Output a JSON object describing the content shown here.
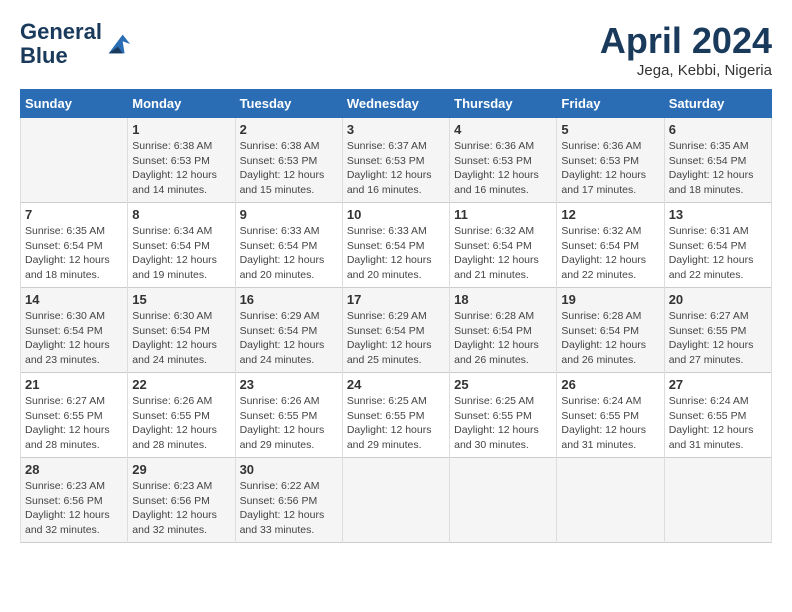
{
  "header": {
    "logo_line1": "General",
    "logo_line2": "Blue",
    "month_year": "April 2024",
    "location": "Jega, Kebbi, Nigeria"
  },
  "days_of_week": [
    "Sunday",
    "Monday",
    "Tuesday",
    "Wednesday",
    "Thursday",
    "Friday",
    "Saturday"
  ],
  "weeks": [
    [
      {
        "day": "",
        "sunrise": "",
        "sunset": "",
        "daylight": ""
      },
      {
        "day": "1",
        "sunrise": "6:38 AM",
        "sunset": "6:53 PM",
        "daylight": "12 hours and 14 minutes."
      },
      {
        "day": "2",
        "sunrise": "6:38 AM",
        "sunset": "6:53 PM",
        "daylight": "12 hours and 15 minutes."
      },
      {
        "day": "3",
        "sunrise": "6:37 AM",
        "sunset": "6:53 PM",
        "daylight": "12 hours and 16 minutes."
      },
      {
        "day": "4",
        "sunrise": "6:36 AM",
        "sunset": "6:53 PM",
        "daylight": "12 hours and 16 minutes."
      },
      {
        "day": "5",
        "sunrise": "6:36 AM",
        "sunset": "6:53 PM",
        "daylight": "12 hours and 17 minutes."
      },
      {
        "day": "6",
        "sunrise": "6:35 AM",
        "sunset": "6:54 PM",
        "daylight": "12 hours and 18 minutes."
      }
    ],
    [
      {
        "day": "7",
        "sunrise": "6:35 AM",
        "sunset": "6:54 PM",
        "daylight": "12 hours and 18 minutes."
      },
      {
        "day": "8",
        "sunrise": "6:34 AM",
        "sunset": "6:54 PM",
        "daylight": "12 hours and 19 minutes."
      },
      {
        "day": "9",
        "sunrise": "6:33 AM",
        "sunset": "6:54 PM",
        "daylight": "12 hours and 20 minutes."
      },
      {
        "day": "10",
        "sunrise": "6:33 AM",
        "sunset": "6:54 PM",
        "daylight": "12 hours and 20 minutes."
      },
      {
        "day": "11",
        "sunrise": "6:32 AM",
        "sunset": "6:54 PM",
        "daylight": "12 hours and 21 minutes."
      },
      {
        "day": "12",
        "sunrise": "6:32 AM",
        "sunset": "6:54 PM",
        "daylight": "12 hours and 22 minutes."
      },
      {
        "day": "13",
        "sunrise": "6:31 AM",
        "sunset": "6:54 PM",
        "daylight": "12 hours and 22 minutes."
      }
    ],
    [
      {
        "day": "14",
        "sunrise": "6:30 AM",
        "sunset": "6:54 PM",
        "daylight": "12 hours and 23 minutes."
      },
      {
        "day": "15",
        "sunrise": "6:30 AM",
        "sunset": "6:54 PM",
        "daylight": "12 hours and 24 minutes."
      },
      {
        "day": "16",
        "sunrise": "6:29 AM",
        "sunset": "6:54 PM",
        "daylight": "12 hours and 24 minutes."
      },
      {
        "day": "17",
        "sunrise": "6:29 AM",
        "sunset": "6:54 PM",
        "daylight": "12 hours and 25 minutes."
      },
      {
        "day": "18",
        "sunrise": "6:28 AM",
        "sunset": "6:54 PM",
        "daylight": "12 hours and 26 minutes."
      },
      {
        "day": "19",
        "sunrise": "6:28 AM",
        "sunset": "6:54 PM",
        "daylight": "12 hours and 26 minutes."
      },
      {
        "day": "20",
        "sunrise": "6:27 AM",
        "sunset": "6:55 PM",
        "daylight": "12 hours and 27 minutes."
      }
    ],
    [
      {
        "day": "21",
        "sunrise": "6:27 AM",
        "sunset": "6:55 PM",
        "daylight": "12 hours and 28 minutes."
      },
      {
        "day": "22",
        "sunrise": "6:26 AM",
        "sunset": "6:55 PM",
        "daylight": "12 hours and 28 minutes."
      },
      {
        "day": "23",
        "sunrise": "6:26 AM",
        "sunset": "6:55 PM",
        "daylight": "12 hours and 29 minutes."
      },
      {
        "day": "24",
        "sunrise": "6:25 AM",
        "sunset": "6:55 PM",
        "daylight": "12 hours and 29 minutes."
      },
      {
        "day": "25",
        "sunrise": "6:25 AM",
        "sunset": "6:55 PM",
        "daylight": "12 hours and 30 minutes."
      },
      {
        "day": "26",
        "sunrise": "6:24 AM",
        "sunset": "6:55 PM",
        "daylight": "12 hours and 31 minutes."
      },
      {
        "day": "27",
        "sunrise": "6:24 AM",
        "sunset": "6:55 PM",
        "daylight": "12 hours and 31 minutes."
      }
    ],
    [
      {
        "day": "28",
        "sunrise": "6:23 AM",
        "sunset": "6:56 PM",
        "daylight": "12 hours and 32 minutes."
      },
      {
        "day": "29",
        "sunrise": "6:23 AM",
        "sunset": "6:56 PM",
        "daylight": "12 hours and 32 minutes."
      },
      {
        "day": "30",
        "sunrise": "6:22 AM",
        "sunset": "6:56 PM",
        "daylight": "12 hours and 33 minutes."
      },
      {
        "day": "",
        "sunrise": "",
        "sunset": "",
        "daylight": ""
      },
      {
        "day": "",
        "sunrise": "",
        "sunset": "",
        "daylight": ""
      },
      {
        "day": "",
        "sunrise": "",
        "sunset": "",
        "daylight": ""
      },
      {
        "day": "",
        "sunrise": "",
        "sunset": "",
        "daylight": ""
      }
    ]
  ]
}
